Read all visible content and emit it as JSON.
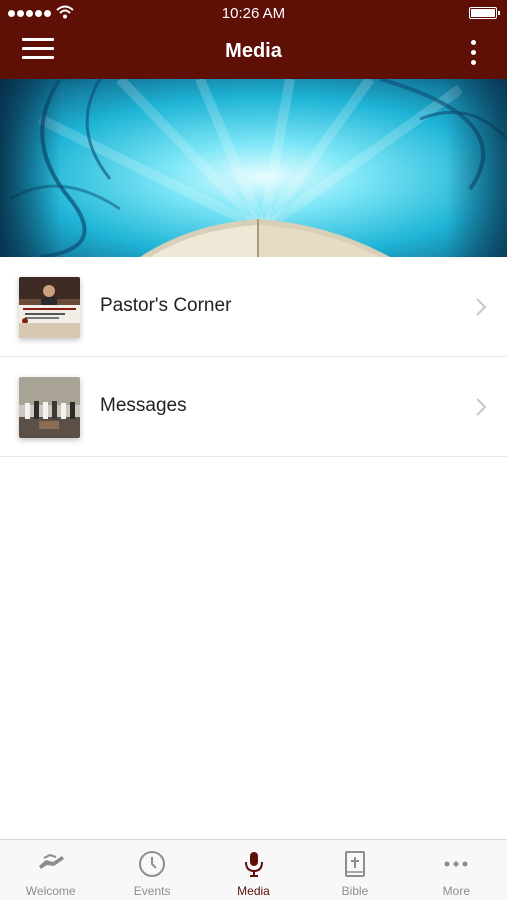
{
  "status_bar": {
    "time": "10:26 AM"
  },
  "nav": {
    "title": "Media"
  },
  "list": [
    {
      "label": "Pastor's Corner"
    },
    {
      "label": "Messages"
    }
  ],
  "tabs": [
    {
      "label": "Welcome",
      "icon": "handshake-icon"
    },
    {
      "label": "Events",
      "icon": "clock-icon"
    },
    {
      "label": "Media",
      "icon": "microphone-icon",
      "active": true
    },
    {
      "label": "Bible",
      "icon": "bible-icon"
    },
    {
      "label": "More",
      "icon": "more-dots-icon"
    }
  ],
  "colors": {
    "brand": "#5e0f06",
    "inactive_tab": "#8e8e8e"
  }
}
